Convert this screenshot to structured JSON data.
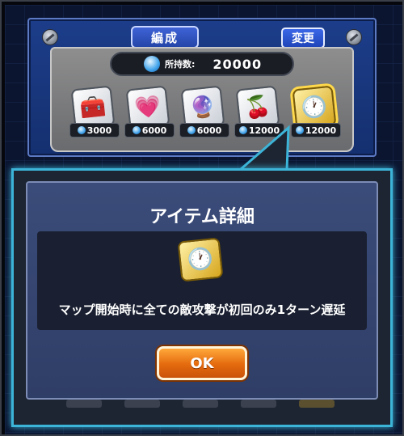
{
  "header": {
    "tab_label": "編成",
    "change_button_label": "変更"
  },
  "shop": {
    "owned_label": "所持数:",
    "owned_value": "20000",
    "items": [
      {
        "name": "treasure-chest-icon",
        "glyph": "🧰",
        "price": "3000"
      },
      {
        "name": "heart-icon",
        "glyph": "💗",
        "price": "6000"
      },
      {
        "name": "crystal-orb-icon",
        "glyph": "🔮",
        "price": "6000"
      },
      {
        "name": "red-berry-icon",
        "glyph": "🍒",
        "price": "12000"
      },
      {
        "name": "clock-icon",
        "glyph": "🕐",
        "price": "12000",
        "selected": true
      }
    ]
  },
  "dialog": {
    "title": "アイテム詳細",
    "item_icon": "clock-icon",
    "item_glyph": "🕐",
    "description": "マップ開始時に全ての敵攻撃が初回のみ1ターン遅延",
    "ok_label": "OK"
  },
  "colors": {
    "dialog_border": "#3cb4d8",
    "ok_button": "#e46a0d",
    "panel_blue": "#1c3d8a",
    "gold_card": "#d6a51c"
  }
}
